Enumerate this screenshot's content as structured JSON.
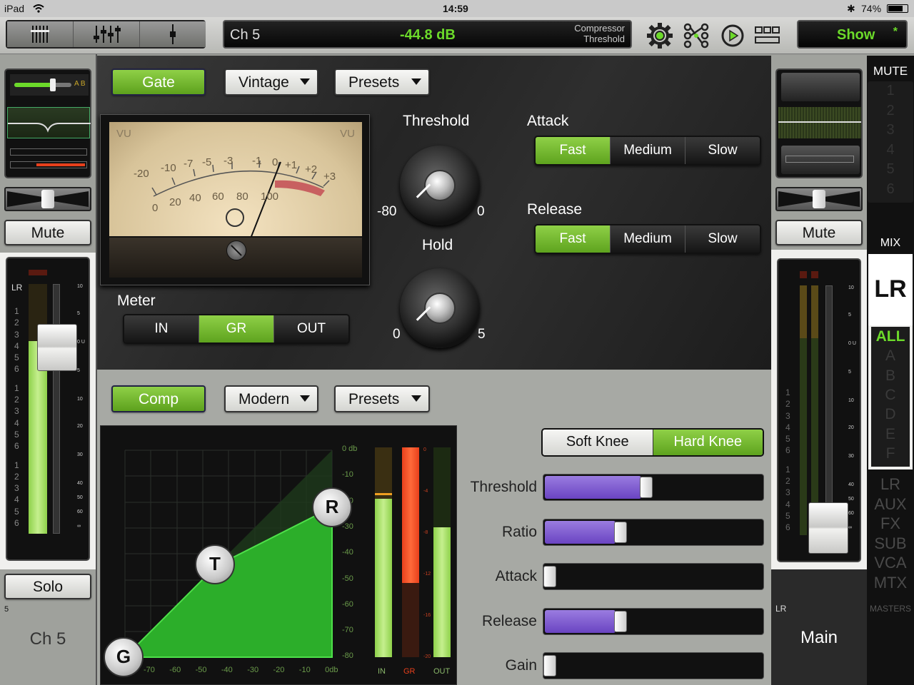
{
  "status": {
    "device": "iPad",
    "time": "14:59",
    "battery": "74%"
  },
  "topbar": {
    "channel": "Ch 5",
    "value": "-44.8 dB",
    "param_line1": "Compressor",
    "param_line2": "Threshold",
    "show_label": "Show",
    "show_star": "*",
    "icons": [
      "mixer-view-icon",
      "faders-view-icon",
      "single-fader-view-icon",
      "gear-icon",
      "routing-icon",
      "play-icon",
      "grid-icon"
    ]
  },
  "left_strip": {
    "ab_label": "A B",
    "mute": "Mute",
    "bus_label": "LR",
    "groups": [
      "1",
      "2",
      "3",
      "4",
      "5",
      "6",
      "1",
      "2",
      "3",
      "4",
      "5",
      "6",
      "1",
      "2",
      "3",
      "4",
      "5",
      "6"
    ],
    "scale": [
      "10",
      "5",
      "0 U",
      "5",
      "10",
      "20",
      "30",
      "40",
      "50",
      "60",
      "∞"
    ],
    "solo": "Solo",
    "channel_number": "5",
    "channel_name": "Ch 5"
  },
  "gate": {
    "toggle_label": "Gate",
    "model_label": "Vintage",
    "presets_label": "Presets",
    "vu_left": "VU",
    "vu_right": "VU",
    "vu_scale_top": [
      "-20",
      "-10",
      "-7",
      "-5",
      "-3",
      "-1",
      "0",
      "+1",
      "+2",
      "+3"
    ],
    "vu_scale_bottom": [
      "0",
      "20",
      "40",
      "60",
      "80",
      "100"
    ],
    "meter_label": "Meter",
    "meter_options": [
      "IN",
      "GR",
      "OUT"
    ],
    "meter_selected": "GR",
    "threshold_label": "Threshold",
    "threshold_min": "-80",
    "threshold_max": "0",
    "hold_label": "Hold",
    "hold_min": "0",
    "hold_max": "5",
    "attack_label": "Attack",
    "attack_options": [
      "Fast",
      "Medium",
      "Slow"
    ],
    "attack_selected": "Fast",
    "release_label": "Release",
    "release_options": [
      "Fast",
      "Medium",
      "Slow"
    ],
    "release_selected": "Fast"
  },
  "comp": {
    "toggle_label": "Comp",
    "model_label": "Modern",
    "presets_label": "Presets",
    "graph_y": [
      "0 db",
      "-10",
      "-20",
      "-30",
      "-40",
      "-50",
      "-60",
      "-70",
      "-80"
    ],
    "graph_x": [
      "-70",
      "-60",
      "-50",
      "-40",
      "-30",
      "-20",
      "-10",
      "0db"
    ],
    "handles": [
      "G",
      "T",
      "R"
    ],
    "meters": [
      "IN",
      "GR",
      "OUT"
    ],
    "gr_scale": [
      "0",
      "-4",
      "-8",
      "-12",
      "-16",
      "-20"
    ],
    "knee_options": [
      "Soft Knee",
      "Hard Knee"
    ],
    "knee_selected": "Hard Knee",
    "params": [
      {
        "label": "Threshold",
        "level": 0.45
      },
      {
        "label": "Ratio",
        "level": 0.33
      },
      {
        "label": "Attack",
        "level": 0.0
      },
      {
        "label": "Release",
        "level": 0.33
      },
      {
        "label": "Gain",
        "level": 0.0
      }
    ]
  },
  "right_strip": {
    "mute": "Mute",
    "groups": [
      "1",
      "2",
      "3",
      "4",
      "5",
      "6",
      "1",
      "2",
      "3",
      "4",
      "5",
      "6"
    ],
    "scale": [
      "10",
      "5",
      "0 U",
      "5",
      "10",
      "20",
      "30",
      "40",
      "50",
      "60",
      "∞"
    ],
    "bus_label": "LR",
    "name": "Main"
  },
  "side_nav": {
    "mute_header": "MUTE",
    "mute_groups": [
      "1",
      "2",
      "3",
      "4",
      "5",
      "6"
    ],
    "mix_label": "MIX",
    "selected_bus": "LR",
    "view_groups": [
      "ALL",
      "A",
      "B",
      "C",
      "D",
      "E",
      "F"
    ],
    "bus_types": [
      "LR",
      "AUX",
      "FX",
      "SUB",
      "VCA",
      "MTX"
    ],
    "masters_label": "MASTERS"
  },
  "colors": {
    "accent_green": "#6cda2a",
    "purple": "#7a5ad0",
    "gr_red": "#e8401c"
  }
}
